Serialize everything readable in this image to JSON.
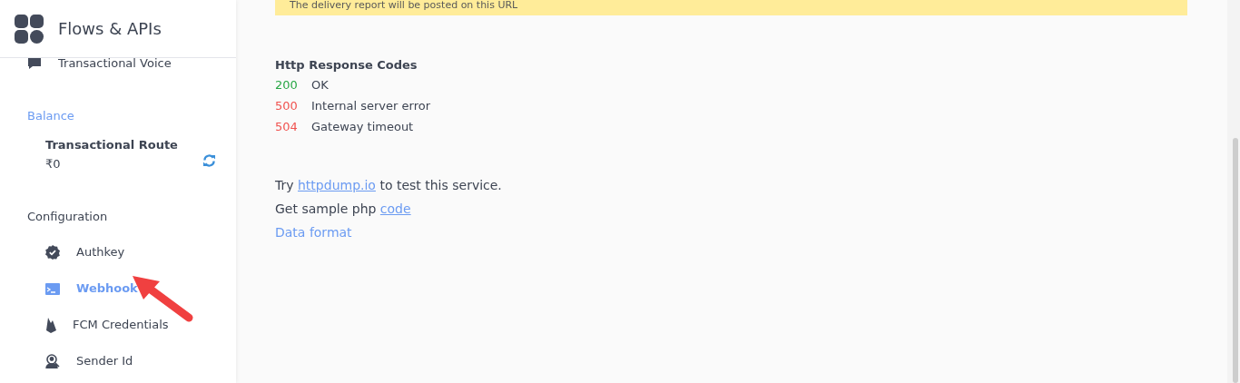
{
  "app": {
    "title": "Flows & APIs"
  },
  "sidebar": {
    "partial_item": {
      "label": "Transactional Voice"
    },
    "balance": {
      "heading": "Balance",
      "route": "Transactional Route",
      "amount": "₹0"
    },
    "configuration": {
      "heading": "Configuration",
      "items": [
        {
          "label": "Authkey",
          "kind": "check",
          "selected": false
        },
        {
          "label": "Webhook",
          "kind": "terminal",
          "selected": true
        },
        {
          "label": "FCM Credentials",
          "kind": "flame",
          "selected": false
        },
        {
          "label": "Sender Id",
          "kind": "person",
          "selected": false
        }
      ]
    }
  },
  "main": {
    "notice": "The delivery report will be posted on this URL",
    "codes_heading": "Http Response Codes",
    "codes": [
      {
        "code": "200",
        "text": "OK",
        "color": "#28a745"
      },
      {
        "code": "500",
        "text": "Internal server error",
        "color": "#f0524f"
      },
      {
        "code": "504",
        "text": "Gateway timeout",
        "color": "#f0524f"
      }
    ],
    "try_line": {
      "before": "Try",
      "link": "httpdump.io",
      "after": "to test this service."
    },
    "sample_line": {
      "before": "Get sample php",
      "link": "code"
    },
    "data_format": "Data format"
  }
}
